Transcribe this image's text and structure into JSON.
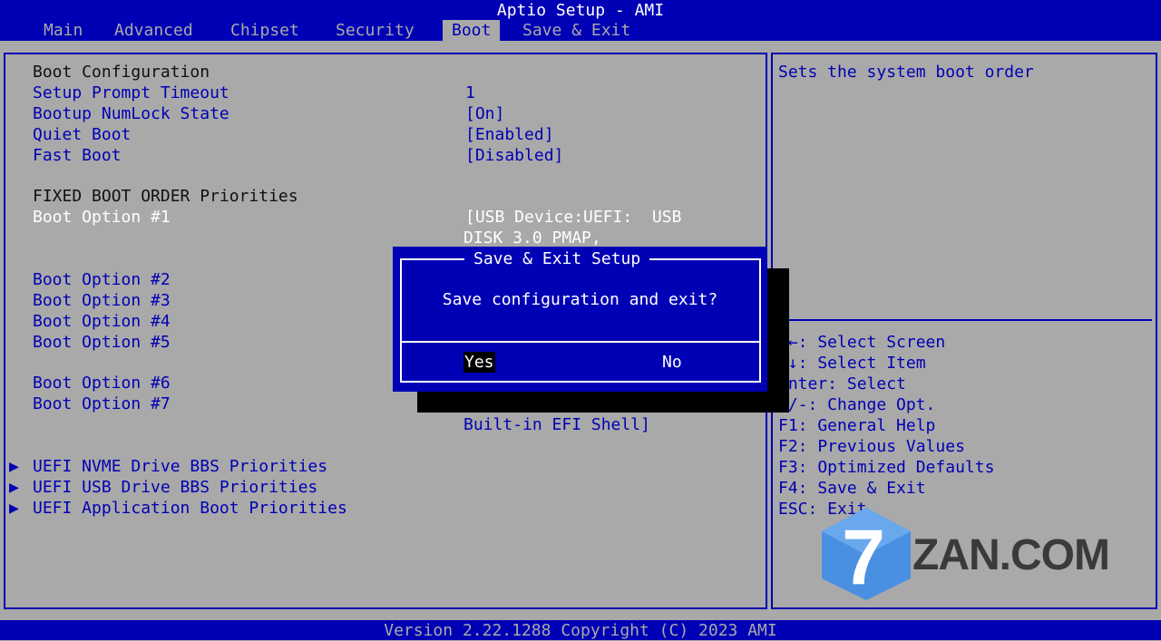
{
  "header": {
    "title": "Aptio Setup - AMI",
    "tabs": [
      {
        "label": "Main"
      },
      {
        "label": "Advanced"
      },
      {
        "label": "Chipset"
      },
      {
        "label": "Security"
      },
      {
        "label": "Boot",
        "active": true
      },
      {
        "label": "Save & Exit"
      }
    ]
  },
  "boot": {
    "section_title": "Boot Configuration",
    "settings": [
      {
        "label": "Setup Prompt Timeout",
        "value": "1"
      },
      {
        "label": "Bootup NumLock State",
        "value": "[On]"
      },
      {
        "label": "Quiet Boot",
        "value": "[Enabled]"
      },
      {
        "label": "Fast Boot",
        "value": "[Disabled]"
      }
    ],
    "priorities_title": "FIXED BOOT ORDER Priorities",
    "options": [
      {
        "label": "Boot Option #1",
        "value_line1": "[USB Device:UEFI:  USB",
        "value_line2": "DISK 3.0 PMAP,"
      },
      {
        "label": "Boot Option #2"
      },
      {
        "label": "Boot Option #3"
      },
      {
        "label": "Boot Option #4"
      },
      {
        "label": "Boot Option #5"
      },
      {
        "label": "Boot Option #6"
      },
      {
        "label": "Boot Option #7",
        "value_line2": "Built-in EFI Shell]"
      }
    ],
    "submenus": [
      {
        "label": "UEFI NVME Drive BBS Priorities"
      },
      {
        "label": "UEFI USB Drive BBS Priorities"
      },
      {
        "label": "UEFI Application Boot Priorities"
      }
    ],
    "submenu_arrow": "▶"
  },
  "help": {
    "description": "Sets the system boot order",
    "keys": [
      "→←: Select Screen",
      "↑↓: Select Item",
      "Enter: Select",
      "+/-: Change Opt.",
      "F1: General Help",
      "F2: Previous Values",
      "F3: Optimized Defaults",
      "F4: Save & Exit",
      "ESC: Exit"
    ]
  },
  "dialog": {
    "title": "Save & Exit Setup",
    "message": "Save configuration and exit?",
    "yes_label": "Yes",
    "no_label": "No"
  },
  "footer": {
    "version": "Version 2.22.1288 Copyright (C) 2023 AMI"
  },
  "watermark": {
    "badge_text": "7",
    "text": "ZAN.COM",
    "badge_color": "#4a90e2"
  },
  "colors": {
    "bios_blue": "#0000b4",
    "panel_gray": "#a9a9a9",
    "white": "#ffffff"
  }
}
